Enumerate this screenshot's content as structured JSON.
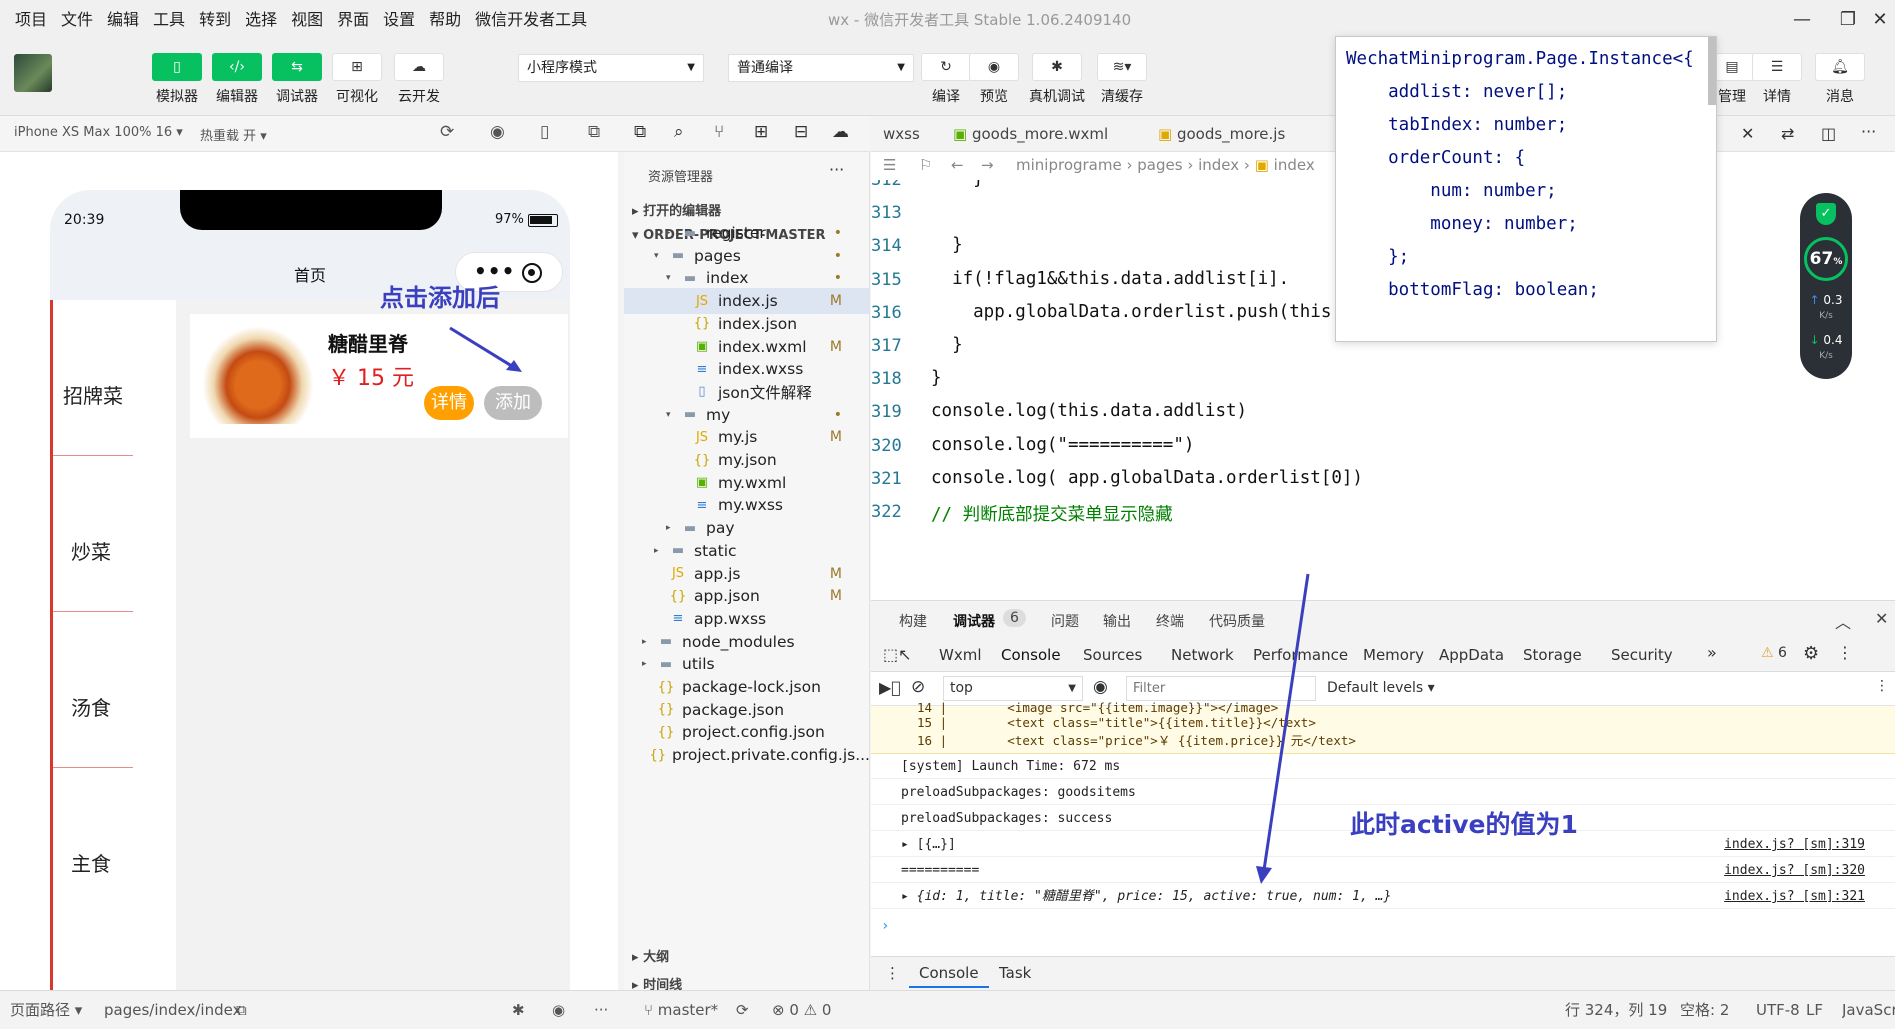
{
  "menu": [
    "项目",
    "文件",
    "编辑",
    "工具",
    "转到",
    "选择",
    "视图",
    "界面",
    "设置",
    "帮助",
    "微信开发者工具"
  ],
  "window_title": "wx - 微信开发者工具 Stable 1.06.2409140",
  "toolbar": {
    "simulator": "模拟器",
    "editor": "编辑器",
    "debugger": "调试器",
    "visual": "可视化",
    "cloud": "云开发",
    "mode_select": "小程序模式",
    "compile_select": "普通编译",
    "compile": "编译",
    "preview": "预览",
    "remote_debug": "真机调试",
    "clear_cache": "清缓存",
    "manage": "管理",
    "details": "详情",
    "messages": "消息"
  },
  "simulator": {
    "device": "iPhone XS Max 100% 16",
    "hot_reload": "热重载 开",
    "time": "20:39",
    "battery": "97%",
    "nav_title": "首页",
    "categories": [
      "招牌菜",
      "炒菜",
      "汤食",
      "主食"
    ],
    "good": {
      "title": "糖醋里脊",
      "price": "￥ 15 元",
      "detail_btn": "详情",
      "add_btn": "添加"
    },
    "annotation": "点击添加后"
  },
  "explorer": {
    "title": "资源管理器",
    "open_editors": "打开的编辑器",
    "project": "ORDER-PROJECT-MASTER",
    "tree": [
      {
        "name": "register",
        "type": "folder",
        "status": "•"
      },
      {
        "name": "pages",
        "type": "folder-open",
        "status": "•"
      },
      {
        "name": "index",
        "type": "folder-open",
        "status": "•"
      },
      {
        "name": "index.js",
        "type": "js",
        "status": "M"
      },
      {
        "name": "index.json",
        "type": "json",
        "status": ""
      },
      {
        "name": "index.wxml",
        "type": "wxml",
        "status": "M"
      },
      {
        "name": "index.wxss",
        "type": "wxss",
        "status": ""
      },
      {
        "name": "json文件解释",
        "type": "doc",
        "status": ""
      },
      {
        "name": "my",
        "type": "folder-open",
        "status": "•"
      },
      {
        "name": "my.js",
        "type": "js",
        "status": "M"
      },
      {
        "name": "my.json",
        "type": "json",
        "status": ""
      },
      {
        "name": "my.wxml",
        "type": "wxml",
        "status": ""
      },
      {
        "name": "my.wxss",
        "type": "wxss",
        "status": ""
      },
      {
        "name": "pay",
        "type": "folder",
        "status": ""
      },
      {
        "name": "static",
        "type": "folder",
        "status": ""
      },
      {
        "name": "app.js",
        "type": "js",
        "status": "M"
      },
      {
        "name": "app.json",
        "type": "json",
        "status": "M"
      },
      {
        "name": "app.wxss",
        "type": "wxss",
        "status": ""
      },
      {
        "name": "node_modules",
        "type": "folder",
        "status": ""
      },
      {
        "name": "utils",
        "type": "folder",
        "status": ""
      },
      {
        "name": "package-lock.json",
        "type": "json",
        "status": ""
      },
      {
        "name": "package.json",
        "type": "json",
        "status": ""
      },
      {
        "name": "project.config.json",
        "type": "json",
        "status": ""
      },
      {
        "name": "project.private.config.js...",
        "type": "json",
        "status": ""
      }
    ],
    "outline": "大纲",
    "timeline": "时间线"
  },
  "editor": {
    "tabs": [
      "wxss",
      "goods_more.wxml",
      "goods_more.js"
    ],
    "breadcrumb": [
      "miniprograme",
      "pages",
      "index",
      "index"
    ],
    "lines": [
      {
        "n": "312",
        "code": "    }"
      },
      {
        "n": "313",
        "code": ""
      },
      {
        "n": "314",
        "code": "  }"
      },
      {
        "n": "315",
        "code": "  if(!flag1&&this.data.addlist[i]."
      },
      {
        "n": "316",
        "code": "    app.globalData.orderlist.push(this.data.addlist[i])"
      },
      {
        "n": "317",
        "code": "  }"
      },
      {
        "n": "318",
        "code": "}"
      },
      {
        "n": "319",
        "code": "console.log(this.data.addlist)"
      },
      {
        "n": "320",
        "code": "console.log(\"==========\")"
      },
      {
        "n": "321",
        "code": "console.log( app.globalData.orderlist[0])"
      },
      {
        "n": "322",
        "code": "// 判断底部提交菜单显示隐藏"
      }
    ],
    "hover": [
      "WechatMiniprogram.Page.Instance<{",
      "    addlist: never[];",
      "    tabIndex: number;",
      "    orderCount: {",
      "        num: number;",
      "        money: number;",
      "    };",
      "    bottomFlag: boolean;"
    ],
    "perf": {
      "percent": "67",
      "up": "0.3",
      "down": "0.4",
      "unit": "K/s"
    }
  },
  "debugger": {
    "panel_tabs": [
      "构建",
      "调试器",
      "6",
      "问题",
      "输出",
      "终端",
      "代码质量"
    ],
    "dev_tabs": [
      "Wxml",
      "Console",
      "Sources",
      "Network",
      "Performance",
      "Memory",
      "AppData",
      "Storage",
      "Security"
    ],
    "warn_count": "6",
    "context": "top",
    "filter_placeholder": "Filter",
    "levels": "Default levels",
    "warn_lines": [
      "14 |        <image src=\"{{item.image}}\"></image>",
      "15 |        <text class=\"title\">{{item.title}}</text>",
      "16 |        <text class=\"price\">￥ {{item.price}} 元</text>"
    ],
    "logs": [
      {
        "text": "[system] Launch Time: 672 ms",
        "src": ""
      },
      {
        "text": "preloadSubpackages: goodsitems",
        "src": ""
      },
      {
        "text": "preloadSubpackages: success",
        "src": ""
      },
      {
        "text": "▸ [{…}]",
        "src": "index.js? [sm]:319"
      },
      {
        "text": "==========",
        "src": "index.js? [sm]:320"
      },
      {
        "text": "▸ {id: 1, title: \"糖醋里脊\", price: 15, active: true, num: 1, …}",
        "src": "index.js? [sm]:321"
      }
    ],
    "annotation": "此时active的值为1",
    "drawer_tabs": [
      "Console",
      "Task"
    ]
  },
  "statusbar": {
    "page_path_label": "页面路径",
    "page_path": "pages/index/index",
    "branch": "master*",
    "problems": "⊗ 0 ⚠ 0",
    "cursor": "行 324，列 19",
    "spaces": "空格: 2",
    "encoding": "UTF-8",
    "eol": "LF",
    "lang": "JavaScri"
  }
}
